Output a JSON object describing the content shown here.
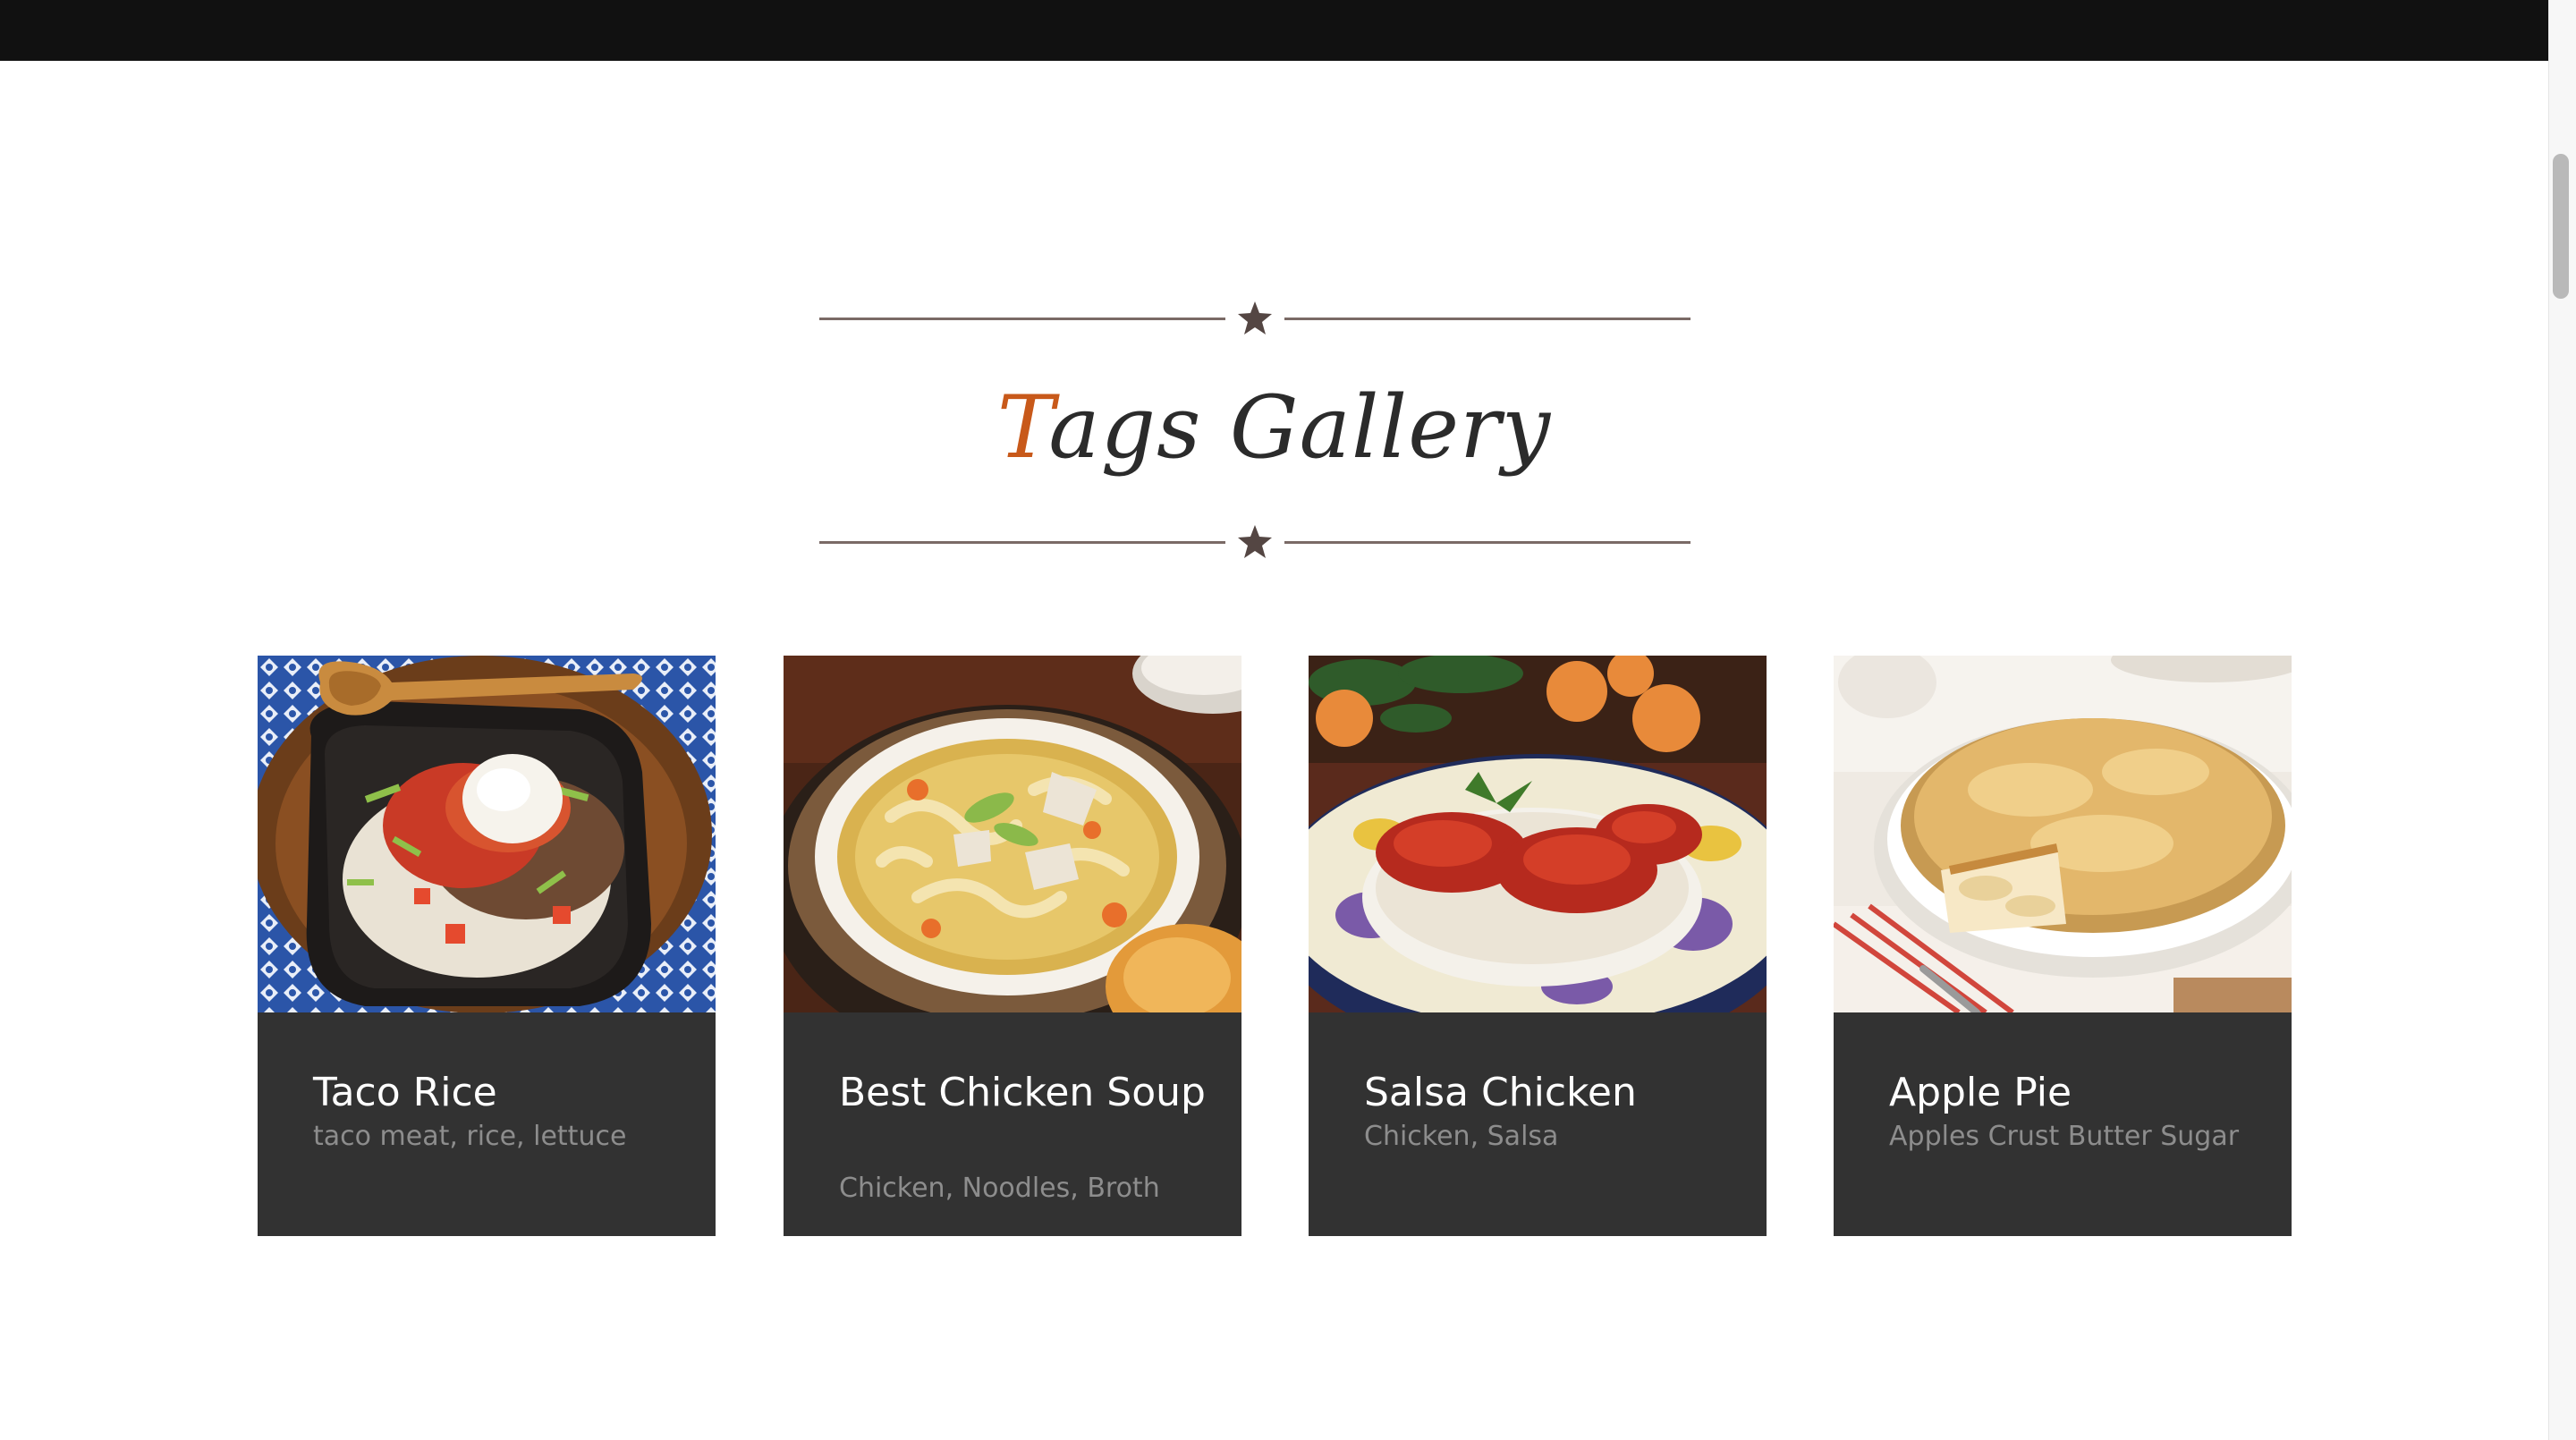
{
  "title": {
    "first_letter": "T",
    "rest": "ags Gallery"
  },
  "colors": {
    "accent": "#c8591a",
    "card_bg": "#323232",
    "topbar": "#111111"
  },
  "divider_icon": "star-icon",
  "cards": [
    {
      "name": "Taco Rice",
      "tags": "taco meat, rice, lettuce"
    },
    {
      "name": "Best Chicken Soup",
      "tags": "Chicken, Noodles, Broth"
    },
    {
      "name": "Salsa Chicken",
      "tags": "Chicken, Salsa"
    },
    {
      "name": "Apple Pie",
      "tags": "Apples Crust Butter Sugar"
    }
  ]
}
